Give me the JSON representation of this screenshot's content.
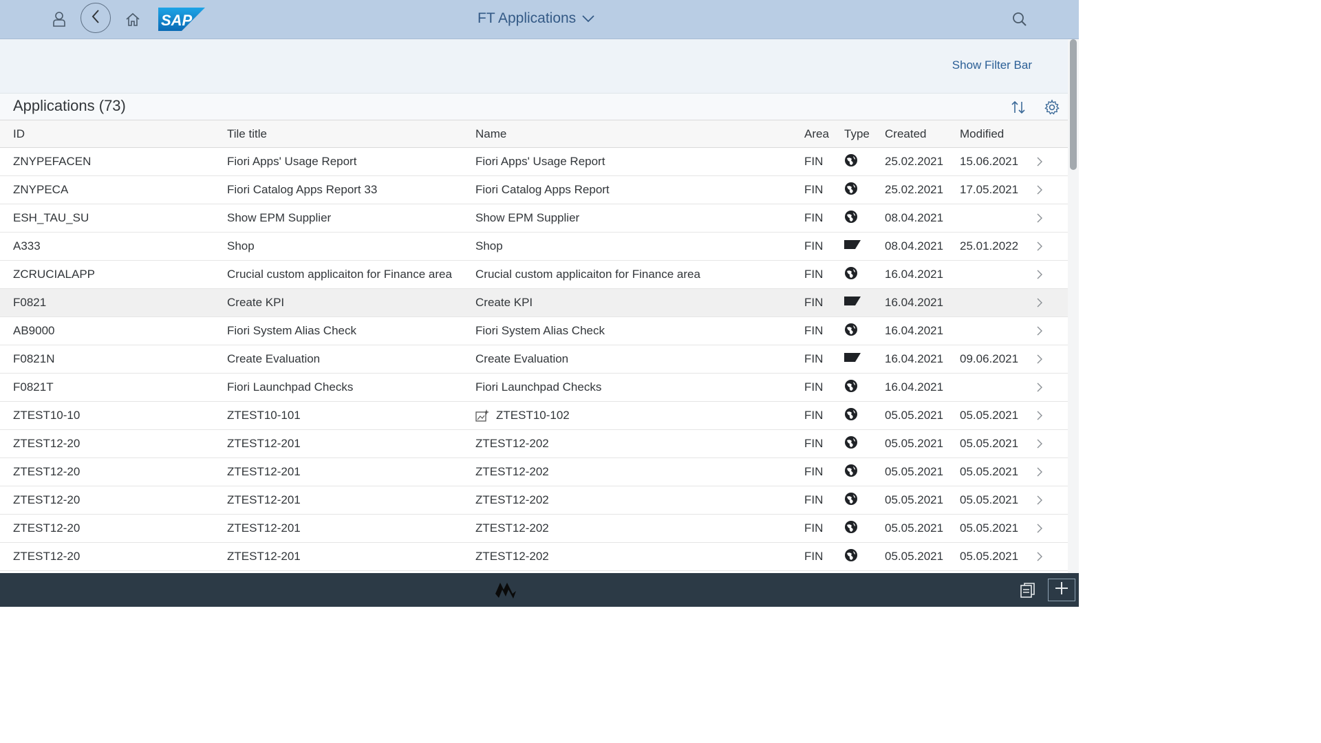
{
  "shell": {
    "title": "FT Applications",
    "logo_text": "SAP",
    "icons": [
      "user-icon",
      "back-icon",
      "home-icon",
      "search-icon",
      "chevron-down-icon"
    ],
    "colors": {
      "shellbar_bg": "#b9cde4",
      "title": "#345a86",
      "footer_bg": "#2c3a46"
    }
  },
  "filterbar": {
    "show_filter_label": "Show Filter Bar"
  },
  "table": {
    "title": "Applications (73)",
    "columns": [
      "ID",
      "Tile title",
      "Name",
      "Area",
      "Type",
      "Created",
      "Modified"
    ],
    "rows": [
      {
        "id": "ZNYPEFACEN",
        "tile": "Fiori Apps' Usage Report",
        "name": "Fiori Apps' Usage Report",
        "area": "FIN",
        "type": "globe-icon",
        "created": "25.02.2021",
        "modified": "15.06.2021"
      },
      {
        "id": "ZNYPECA",
        "tile": "Fiori Catalog Apps Report 33",
        "name": "Fiori Catalog Apps Report",
        "area": "FIN",
        "type": "globe-icon",
        "created": "25.02.2021",
        "modified": "17.05.2021"
      },
      {
        "id": "ESH_TAU_SU",
        "tile": "Show EPM Supplier",
        "name": "Show EPM Supplier",
        "area": "FIN",
        "type": "globe-icon",
        "created": "08.04.2021",
        "modified": ""
      },
      {
        "id": "A333",
        "tile": "Shop",
        "name": "Shop",
        "area": "FIN",
        "type": "flag-icon",
        "created": "08.04.2021",
        "modified": "25.01.2022"
      },
      {
        "id": "ZCRUCIALAPP",
        "tile": "Crucial custom applicaiton for Finance area",
        "name": "Crucial custom applicaiton for Finance area",
        "area": "FIN",
        "type": "globe-icon",
        "created": "16.04.2021",
        "modified": ""
      },
      {
        "id": "F0821",
        "tile": "Create KPI",
        "name": "Create KPI",
        "area": "FIN",
        "type": "flag-icon",
        "created": "16.04.2021",
        "modified": "",
        "selected": true
      },
      {
        "id": "AB9000",
        "tile": "Fiori System Alias Check",
        "name": "Fiori System Alias Check",
        "area": "FIN",
        "type": "globe-icon",
        "created": "16.04.2021",
        "modified": ""
      },
      {
        "id": "F0821N",
        "tile": "Create Evaluation",
        "name": "Create Evaluation",
        "area": "FIN",
        "type": "flag-icon",
        "created": "16.04.2021",
        "modified": "09.06.2021"
      },
      {
        "id": "F0821T",
        "tile": "Fiori Launchpad Checks",
        "name": "Fiori Launchpad Checks",
        "area": "FIN",
        "type": "globe-icon",
        "created": "16.04.2021",
        "modified": ""
      },
      {
        "id": "ZTEST10-10",
        "tile": "ZTEST10-101",
        "name": "ZTEST10-102",
        "name_icon": "image-sparkle-icon",
        "area": "FIN",
        "type": "globe-icon",
        "created": "05.05.2021",
        "modified": "05.05.2021"
      },
      {
        "id": "ZTEST12-20",
        "tile": "ZTEST12-201",
        "name": "ZTEST12-202",
        "area": "FIN",
        "type": "globe-icon",
        "created": "05.05.2021",
        "modified": "05.05.2021"
      },
      {
        "id": "ZTEST12-20",
        "tile": "ZTEST12-201",
        "name": "ZTEST12-202",
        "area": "FIN",
        "type": "globe-icon",
        "created": "05.05.2021",
        "modified": "05.05.2021"
      },
      {
        "id": "ZTEST12-20",
        "tile": "ZTEST12-201",
        "name": "ZTEST12-202",
        "area": "FIN",
        "type": "globe-icon",
        "created": "05.05.2021",
        "modified": "05.05.2021"
      },
      {
        "id": "ZTEST12-20",
        "tile": "ZTEST12-201",
        "name": "ZTEST12-202",
        "area": "FIN",
        "type": "globe-icon",
        "created": "05.05.2021",
        "modified": "05.05.2021"
      },
      {
        "id": "ZTEST12-20",
        "tile": "ZTEST12-201",
        "name": "ZTEST12-202",
        "area": "FIN",
        "type": "globe-icon",
        "created": "05.05.2021",
        "modified": "05.05.2021"
      }
    ]
  },
  "footer": {
    "icons": [
      "sap-logo-icon",
      "copy-icon",
      "add-icon"
    ]
  }
}
